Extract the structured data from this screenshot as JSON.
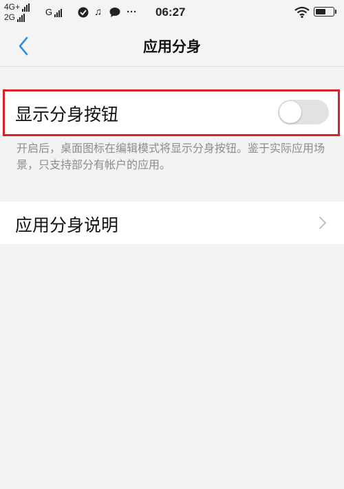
{
  "status_bar": {
    "network_top": "4G+",
    "network_bottom": "2G",
    "network_g": "G",
    "time": "06:27",
    "more": "···"
  },
  "header": {
    "title": "应用分身",
    "back_icon": "chevron-left-icon"
  },
  "toggle_setting": {
    "label": "显示分身按钮",
    "enabled": false,
    "description": "开启后，桌面图标在编辑模式将显示分身按钮。鉴于实际应用场景，只支持部分有帐户的应用。"
  },
  "info_item": {
    "label": "应用分身说明",
    "icon": "chevron-right-icon"
  },
  "colors": {
    "accent": "#2c8fe0",
    "highlight_border": "#d6202a",
    "background": "#f2f2f2"
  }
}
